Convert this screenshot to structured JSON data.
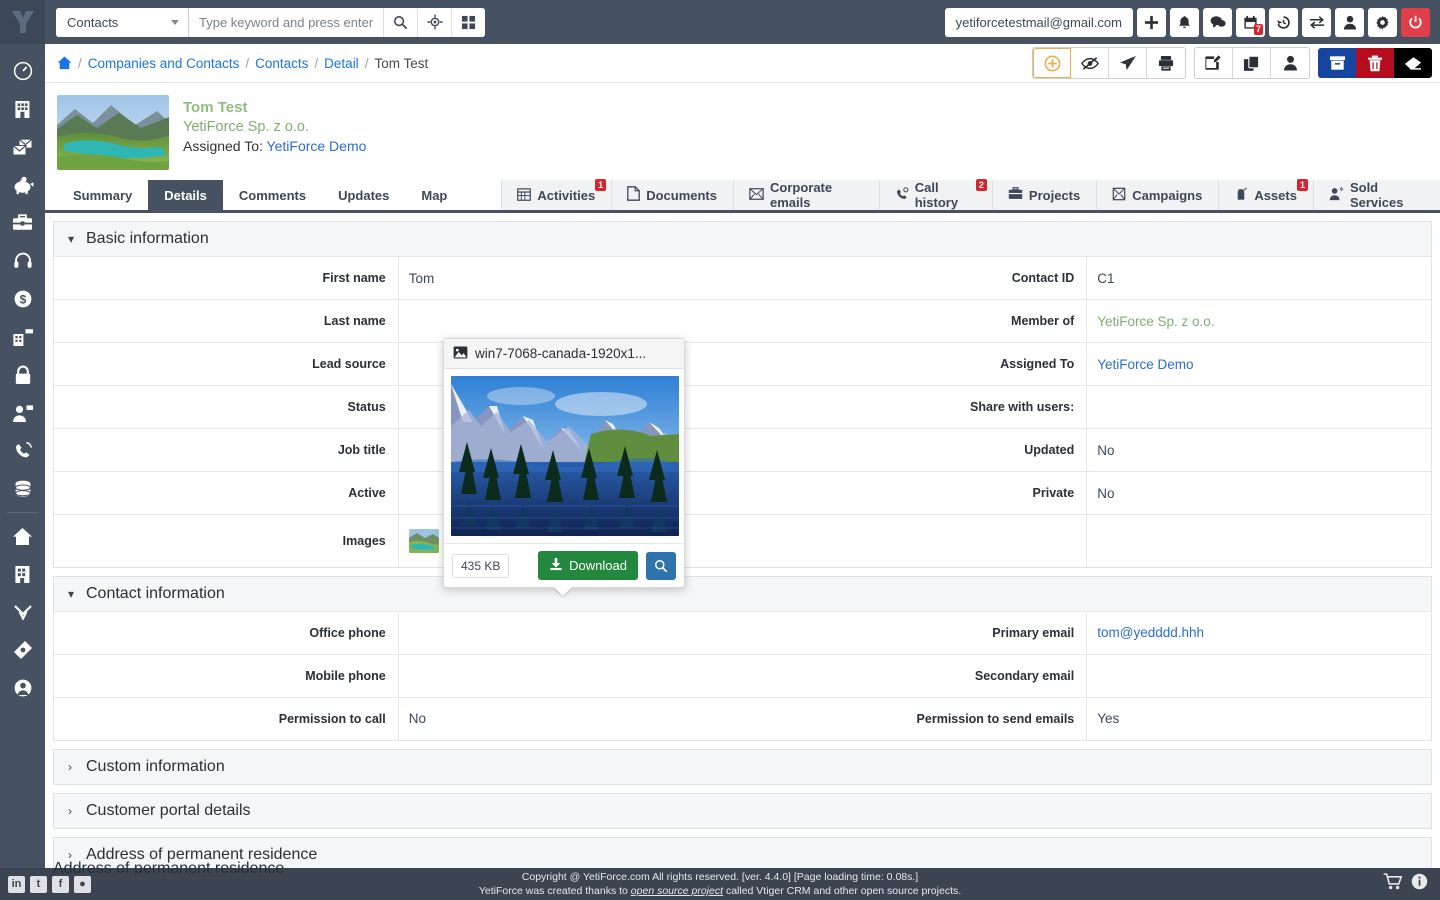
{
  "topbar": {
    "module_selected": "Contacts",
    "search_placeholder": "Type keyword and press enter",
    "search_value": "",
    "user_email": "yetiforcetestmail@gmail.com",
    "icons": [
      {
        "name": "add-icon",
        "glyph": "+"
      },
      {
        "name": "bell-icon",
        "glyph": "🔔"
      },
      {
        "name": "chat-icon",
        "glyph": "💬"
      },
      {
        "name": "calendar-icon",
        "glyph": "📅",
        "badge": "7"
      },
      {
        "name": "history-icon",
        "glyph": "↺"
      },
      {
        "name": "switch-icon",
        "glyph": "⇄"
      },
      {
        "name": "user-icon",
        "glyph": "👤"
      },
      {
        "name": "gear-icon",
        "glyph": "⚙"
      },
      {
        "name": "power-icon",
        "glyph": "⏻"
      }
    ]
  },
  "sidebar": {
    "items": [
      {
        "name": "dashboard-icon",
        "label": "Dashboard"
      },
      {
        "name": "company-icon",
        "label": "Companies and Contacts"
      },
      {
        "name": "mail-icon",
        "label": "Mail"
      },
      {
        "name": "piggy-bank-icon",
        "label": "Finances"
      },
      {
        "name": "briefcase-icon",
        "label": "Projects"
      },
      {
        "name": "headset-icon",
        "label": "Support"
      },
      {
        "name": "dollar-icon",
        "label": "Sales"
      },
      {
        "name": "logistics-icon",
        "label": "Logistics"
      },
      {
        "name": "lock-icon",
        "label": "Security"
      },
      {
        "name": "employee-icon",
        "label": "Human Resources"
      },
      {
        "name": "call-icon",
        "label": "Call center"
      },
      {
        "name": "database-icon",
        "label": "Database"
      }
    ],
    "bottom_items": [
      {
        "name": "home-icon",
        "label": "Home"
      },
      {
        "name": "building-icon",
        "label": "Companies"
      },
      {
        "name": "funnel-icon",
        "label": "Leads"
      },
      {
        "name": "ticket-icon",
        "label": "Tickets"
      },
      {
        "name": "account-icon",
        "label": "Account"
      }
    ]
  },
  "breadcrumb": {
    "home_label": "Home",
    "items": [
      {
        "label": "Companies and Contacts",
        "link": true
      },
      {
        "label": "Contacts",
        "link": true
      },
      {
        "label": "Detail",
        "link": true
      },
      {
        "label": "Tom Test",
        "link": false
      }
    ],
    "separator": "/"
  },
  "record_actions": {
    "group1": [
      {
        "name": "add-related-button",
        "glyph": "⊕",
        "style": "accent"
      },
      {
        "name": "watch-off-button",
        "glyph": "👁"
      },
      {
        "name": "send-button",
        "glyph": "➤"
      },
      {
        "name": "pdf-export-button",
        "glyph": "🗄"
      }
    ],
    "group2": [
      {
        "name": "edit-button",
        "glyph": "✎"
      },
      {
        "name": "duplicate-button",
        "glyph": "⧉"
      },
      {
        "name": "assign-user-button",
        "glyph": "👤"
      }
    ],
    "group3": [
      {
        "name": "archive-button",
        "glyph": "🗃",
        "color": "blue"
      },
      {
        "name": "delete-button",
        "glyph": "🗑",
        "color": "red"
      },
      {
        "name": "erase-button",
        "glyph": "◆",
        "color": "black"
      }
    ]
  },
  "record": {
    "title": "Tom Test",
    "subtitle": "YetiForce Sp. z o.o.",
    "assigned_prefix": "Assigned To:",
    "assigned_to": "YetiForce Demo"
  },
  "tabs": {
    "left": [
      {
        "label": "Summary",
        "active": false
      },
      {
        "label": "Details",
        "active": true
      },
      {
        "label": "Comments",
        "active": false
      },
      {
        "label": "Updates",
        "active": false
      },
      {
        "label": "Map",
        "active": false
      }
    ],
    "related": [
      {
        "label": "Activities",
        "icon": "calendar-icon",
        "badge": "1"
      },
      {
        "label": "Documents",
        "icon": "file-icon",
        "badge": ""
      },
      {
        "label": "Corporate emails",
        "icon": "envelope-icon",
        "badge": ""
      },
      {
        "label": "Call history",
        "icon": "phone-icon",
        "badge": "2"
      },
      {
        "label": "Projects",
        "icon": "briefcase-icon",
        "badge": ""
      },
      {
        "label": "Campaigns",
        "icon": "megaphone-icon",
        "badge": ""
      },
      {
        "label": "Assets",
        "icon": "asset-icon",
        "badge": "1"
      },
      {
        "label": "Sold Services",
        "icon": "service-icon",
        "badge": ""
      }
    ]
  },
  "blocks": {
    "basic": {
      "title": "Basic information",
      "expanded": true,
      "rows": [
        {
          "l_label": "First name",
          "l_value": "Tom",
          "l_type": "text",
          "r_label": "Contact ID",
          "r_value": "C1",
          "r_type": "text"
        },
        {
          "l_label": "Last name",
          "l_value": "",
          "l_type": "text",
          "r_label": "Member of",
          "r_value": "YetiForce Sp. z o.o.",
          "r_type": "link-green"
        },
        {
          "l_label": "Lead source",
          "l_value": "",
          "l_type": "text",
          "r_label": "Assigned To",
          "r_value": "YetiForce Demo",
          "r_type": "link"
        },
        {
          "l_label": "Status",
          "l_value": "",
          "l_type": "text",
          "r_label": "Share with users:",
          "r_value": "",
          "r_type": "text"
        },
        {
          "l_label": "Job title",
          "l_value": "",
          "l_type": "text",
          "r_label": "Updated",
          "r_value": "No",
          "r_type": "text"
        },
        {
          "l_label": "Active",
          "l_value": "",
          "l_type": "text",
          "r_label": "Private",
          "r_value": "No",
          "r_type": "text"
        },
        {
          "l_label": "Images",
          "l_value": "",
          "l_type": "thumbs",
          "r_label": "",
          "r_value": "",
          "r_type": "text"
        }
      ]
    },
    "contact": {
      "title": "Contact information",
      "expanded": true,
      "rows": [
        {
          "l_label": "Office phone",
          "l_value": "",
          "l_type": "text",
          "r_label": "Primary email",
          "r_value": "tom@yedddd.hhh",
          "r_type": "link"
        },
        {
          "l_label": "Mobile phone",
          "l_value": "",
          "l_type": "text",
          "r_label": "Secondary email",
          "r_value": "",
          "r_type": "text"
        },
        {
          "l_label": "Permission to call",
          "l_value": "No",
          "l_type": "text",
          "r_label": "Permission to send emails",
          "r_value": "Yes",
          "r_type": "text"
        }
      ]
    },
    "custom": {
      "title": "Custom information",
      "expanded": false
    },
    "portal": {
      "title": "Customer portal details",
      "expanded": false
    },
    "address": {
      "title": "Address of permanent residence",
      "expanded": false
    }
  },
  "image_popup": {
    "filename": "win7-7068-canada-1920x1...",
    "size": "435 KB",
    "download_label": "Download",
    "zoom_label": "Preview"
  },
  "footer": {
    "copyright": "Copyright @ YetiForce.com All rights reserved. [ver. 4.4.0] [Page loading time: 0.08s.]",
    "credit_pre": "YetiForce was created thanks to ",
    "credit_link": "open source project",
    "credit_post": " called Vtiger CRM and other open source projects.",
    "social": [
      {
        "name": "linkedin-icon",
        "glyph": "in"
      },
      {
        "name": "twitter-icon",
        "glyph": "t"
      },
      {
        "name": "facebook-icon",
        "glyph": "f"
      },
      {
        "name": "github-icon",
        "glyph": "●"
      }
    ],
    "right_icons": [
      {
        "name": "cart-icon",
        "glyph": "🛒"
      },
      {
        "name": "info-icon",
        "glyph": "ℹ"
      }
    ]
  },
  "colors": {
    "chrome": "#465161",
    "accent_blue": "#1a73e8",
    "green": "#7fae72",
    "danger": "#d9232d",
    "download_green": "#21883d"
  }
}
